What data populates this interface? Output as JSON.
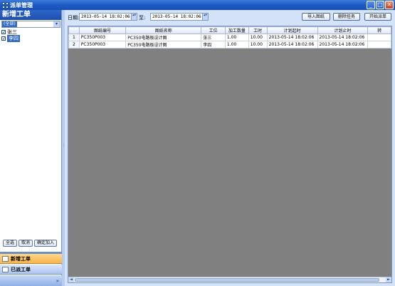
{
  "window": {
    "title": "派单管理",
    "min": "_",
    "max": "□",
    "close": "✕"
  },
  "left": {
    "header": "新增工单",
    "select_value": "(全部)",
    "people": [
      {
        "name": "张三",
        "checked": true,
        "selected": false
      },
      {
        "name": "李四",
        "checked": true,
        "selected": true
      }
    ],
    "buttons": {
      "select_all": "全选",
      "cancel": "取消",
      "confirm_add": "确定加入"
    },
    "nav": {
      "new_order": "新增工单",
      "dispatched": "已派工单"
    },
    "nav_more": "»",
    "grip": "⋮",
    "dropdown_arrow": "▾"
  },
  "toolbar": {
    "date_label": "日期:",
    "to_label": "至:",
    "date_from": "2013-05-14 18:02:06",
    "date_to": "2013-05-14 18:02:06",
    "spin_glyph": "▲▼",
    "import_btn": "导入图纸",
    "delete_btn": "删除任务",
    "dispatch_btn": "开始派单"
  },
  "grid": {
    "columns": [
      "",
      "图纸编号",
      "图纸名称",
      "工位",
      "加工数量",
      "工时",
      "计划起时",
      "计划止时",
      "转"
    ],
    "rows": [
      [
        "1",
        "PC350P003",
        "PC350电路板设计图",
        "张三",
        "1.00",
        "10.00",
        "2013-05-14 18:02:06",
        "2013-05-14 18:02:06",
        ""
      ],
      [
        "2",
        "PC350P003",
        "PC350电路板设计图",
        "李四",
        "1.00",
        "10.00",
        "2013-05-14 18:02:06",
        "2013-05-14 18:02:06",
        ""
      ]
    ],
    "scroll_left": "◄",
    "scroll_right": "►"
  }
}
